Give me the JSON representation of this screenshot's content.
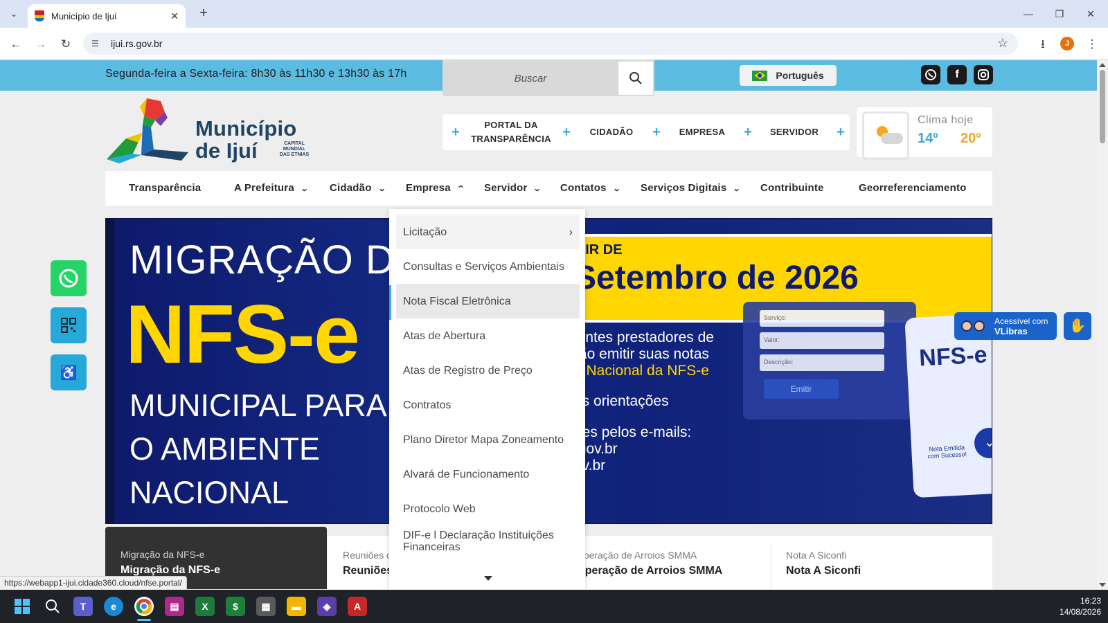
{
  "browser": {
    "tab_title": "Município de Ijuí",
    "url": "ijui.rs.gov.br",
    "profile_initial": "J",
    "status_url": "https://webapp1-ijui.cidade360.cloud/nfse.portal/"
  },
  "topbar": {
    "hours": "Segunda-feira a Sexta-feira: 8h30 às 11h30 e 13h30 às 17h",
    "search_placeholder": "Buscar",
    "language": "Português"
  },
  "logo": {
    "line1": "Município",
    "line2": "de Ijuí",
    "sub": "CAPITAL MUNDIAL DAS ETNIAS"
  },
  "quicknav": {
    "items": [
      "PORTAL DA TRANSPARÊNCIA",
      "CIDADÃO",
      "EMPRESA",
      "SERVIDOR"
    ]
  },
  "weather": {
    "label": "Clima hoje",
    "min": "14º",
    "max": "20º"
  },
  "mainnav": {
    "items": [
      {
        "label": "Transparência"
      },
      {
        "label": "A Prefeitura"
      },
      {
        "label": "Cidadão"
      },
      {
        "label": "Empresa"
      },
      {
        "label": "Servidor"
      },
      {
        "label": "Contatos"
      },
      {
        "label": "Serviços Digitais"
      },
      {
        "label": "Contribuinte"
      },
      {
        "label": "Georreferenciamento"
      }
    ]
  },
  "dropdown": {
    "items": [
      "Licitação",
      "Consultas e Serviços Ambientais",
      "Nota Fiscal Eletrônica",
      "Atas de Abertura",
      "Atas de Registro de Preço",
      "Contratos",
      "Plano Diretor Mapa Zoneamento",
      "Alvará de Funcionamento",
      "Protocolo Web",
      "DIF-e l Declaração Instituições Financeiras"
    ]
  },
  "hero": {
    "line1": "MIGRAÇÃO DA",
    "line2": "NFS-e",
    "line3": "MUNICIPAL PARA",
    "line4": "O AMBIENTE",
    "line5": "NACIONAL",
    "yellow_small": "TIR DE",
    "yellow_big": "Setembro de 2026",
    "body1": "uintes prestadores de",
    "body2": "rão emitir suas notas",
    "body3": "e Nacional da NFS-e",
    "body4": "as orientações",
    "body5": "ões pelos e-mails:",
    "body6": ".gov.br",
    "body7": "ov.br",
    "form_field1": "Serviço:",
    "form_field2": "Valor:",
    "form_field3": "Descrição:",
    "form_button": "Emitir",
    "card_title": "NFS-e",
    "card_note": "Nota Emitida com Sucesso!"
  },
  "news": [
    {
      "small": "Migração da NFS-e",
      "title": "Migração da NFS-e"
    },
    {
      "small": "Reuniões c",
      "title": "Reuniões"
    },
    {
      "small": "uperação de Arroios SMMA",
      "title": "uperação de Arroios SMMA"
    },
    {
      "small": "Nota A Siconfi",
      "title": "Nota A Siconfi"
    }
  ],
  "vlibras": {
    "line1": "Acessível com",
    "line2": "VLibras"
  },
  "taskbar": {
    "time": "16:23",
    "date": "14/08/2026"
  },
  "colors": {
    "topband": "#5bbbe0",
    "accent_blue": "#3aa7de",
    "hero_yellow": "#ffd600",
    "hero_navy": "#0e1a6b",
    "logo_navy": "#1f4466",
    "weather_orange": "#f5a623"
  }
}
